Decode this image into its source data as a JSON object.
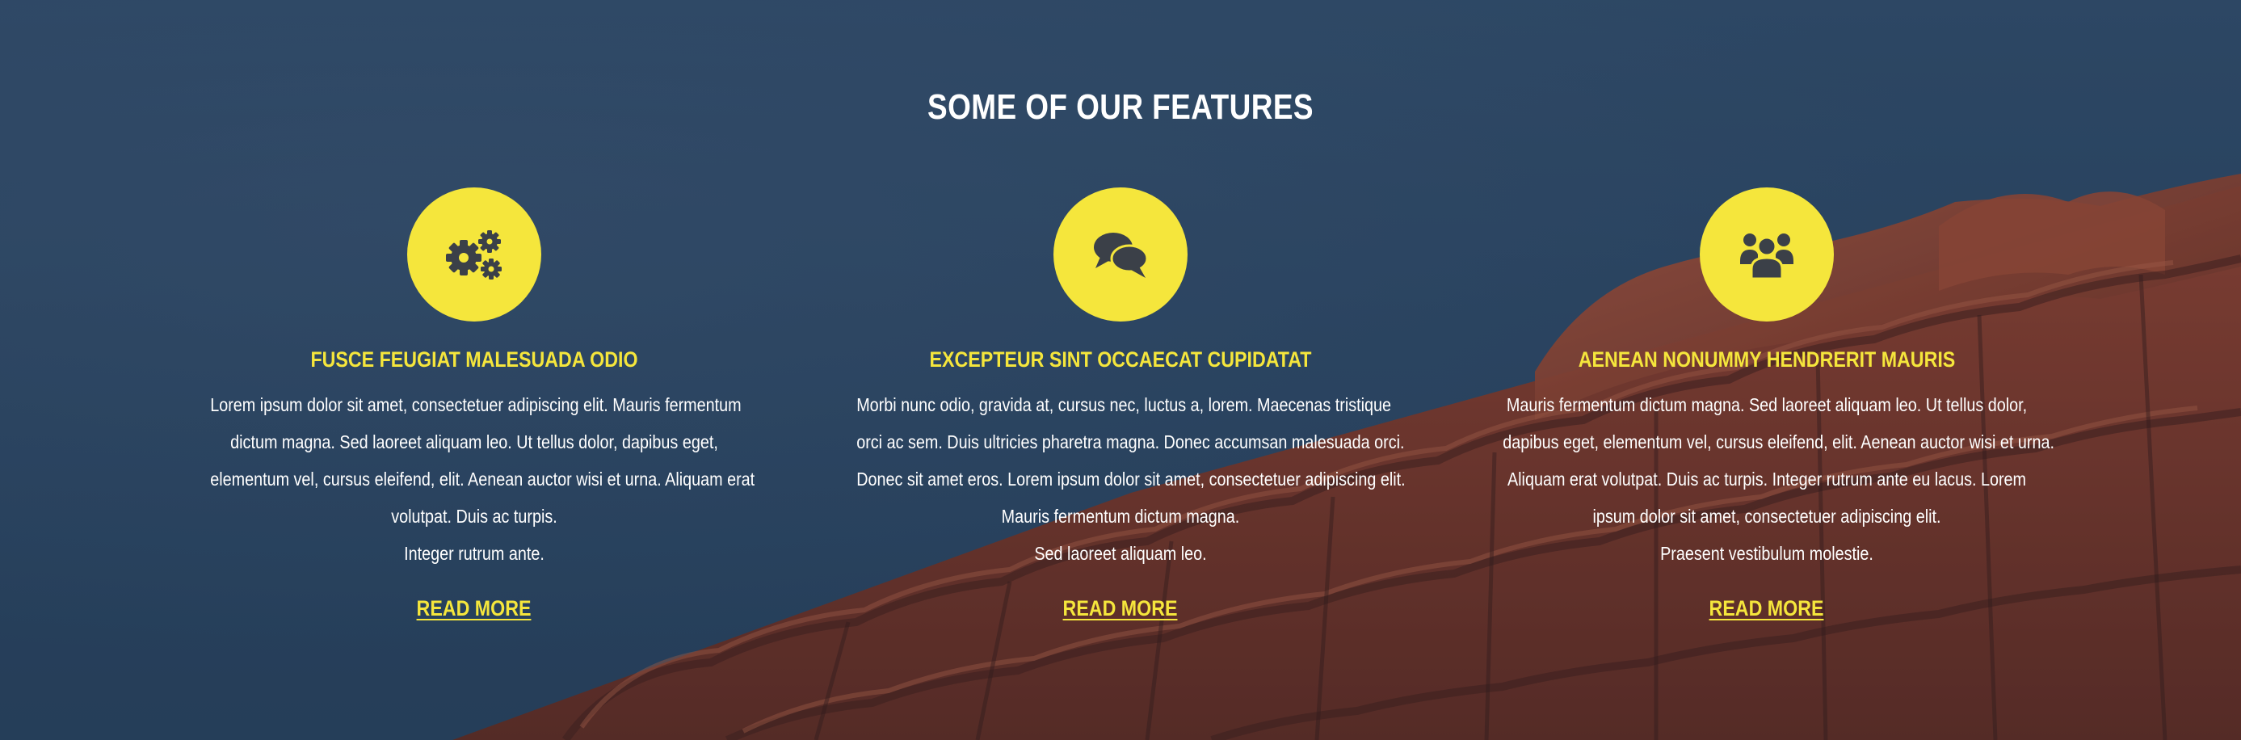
{
  "section": {
    "title": "SOME OF OUR FEATURES"
  },
  "colors": {
    "accent": "#f5e63c",
    "icon_glyph": "#3b4048",
    "text": "#ffffff"
  },
  "features": [
    {
      "icon": "gears-icon",
      "title": "FUSCE FEUGIAT MALESUADA ODIO",
      "lines": [
        "Lorem ipsum dolor sit amet, consectetuer adipiscing elit. Mauris fermentum",
        "dictum magna. Sed laoreet aliquam leo. Ut tellus dolor, dapibus eget,",
        "elementum vel, cursus eleifend, elit. Aenean auctor wisi et urna. Aliquam erat",
        "volutpat. Duis ac turpis.",
        "Integer rutrum ante."
      ],
      "link": "READ MORE"
    },
    {
      "icon": "chat-bubbles-icon",
      "title": "EXCEPTEUR SINT OCCAECAT CUPIDATAT",
      "lines": [
        "Morbi nunc odio, gravida at, cursus nec, luctus a, lorem. Maecenas tristique",
        "orci ac sem. Duis ultricies pharetra magna. Donec accumsan malesuada orci.",
        "Donec sit amet eros. Lorem ipsum dolor sit amet, consectetuer adipiscing elit.",
        "Mauris fermentum dictum magna.",
        "Sed laoreet aliquam leo."
      ],
      "link": "READ MORE"
    },
    {
      "icon": "users-group-icon",
      "title": "AENEAN NONUMMY HENDRERIT MAURIS",
      "lines": [
        "Mauris fermentum dictum magna. Sed laoreet aliquam leo. Ut tellus dolor,",
        "dapibus eget, elementum vel, cursus eleifend, elit. Aenean auctor wisi et urna.",
        "Aliquam erat volutpat. Duis ac turpis. Integer rutrum ante eu lacus. Lorem",
        "ipsum dolor sit amet, consectetuer adipiscing elit.",
        "Praesent vestibulum molestie."
      ],
      "link": "READ MORE"
    }
  ]
}
